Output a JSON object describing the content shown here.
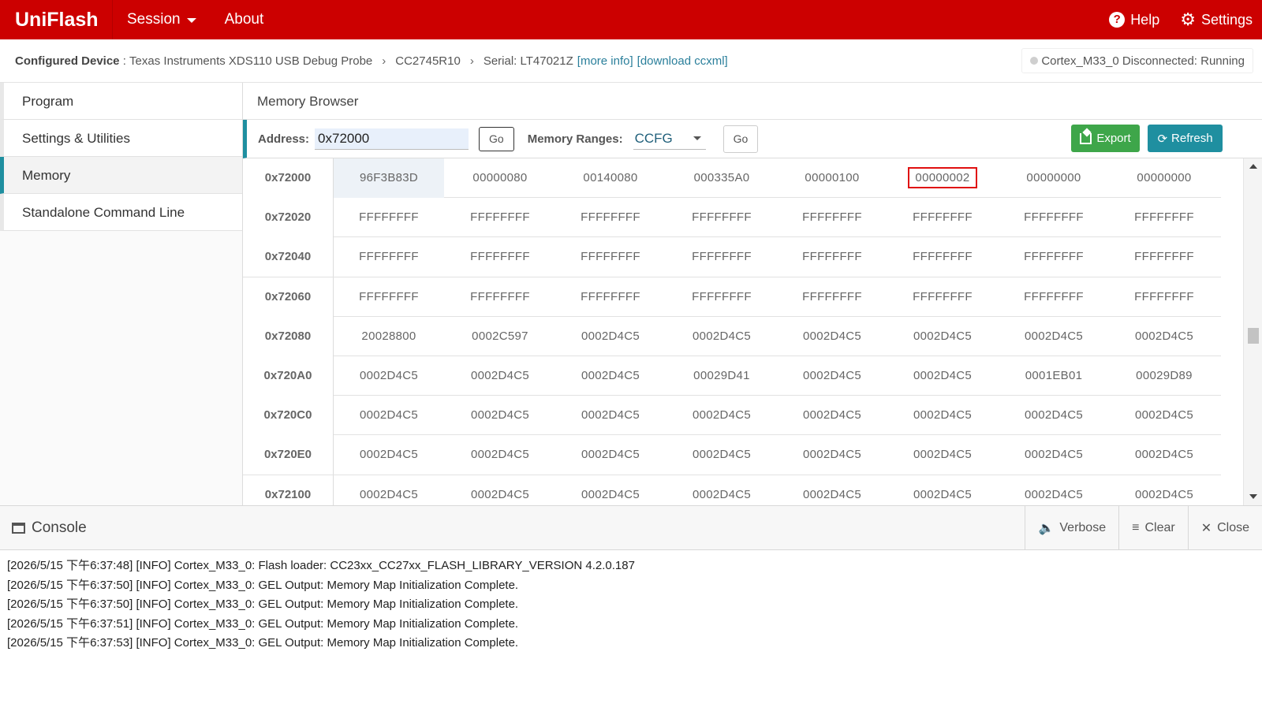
{
  "app": {
    "brand": "UniFlash",
    "menu": [
      {
        "label": "Session"
      },
      {
        "label": "About"
      }
    ],
    "help_label": "Help",
    "settings_label": "Settings"
  },
  "device": {
    "configured_label": "Configured Device",
    "probe": "Texas Instruments XDS110 USB Debug Probe",
    "chip": "CC2745R10",
    "serial": "Serial: LT47021Z",
    "more_info": "[more info]",
    "download_ccxml": "[download ccxml]",
    "status": "Cortex_M33_0 Disconnected: Running"
  },
  "sidebar": {
    "items": [
      {
        "label": "Program"
      },
      {
        "label": "Settings & Utilities"
      },
      {
        "label": "Memory"
      },
      {
        "label": "Standalone Command Line"
      }
    ]
  },
  "memory": {
    "title": "Memory Browser",
    "address_label": "Address:",
    "address_value": "0x72000",
    "go_label": "Go",
    "ranges_label": "Memory Ranges:",
    "range_value": "CCFG",
    "go2_label": "Go",
    "export_label": "Export",
    "refresh_label": "Refresh",
    "rows": [
      {
        "addr": "0x72000",
        "cells": [
          "96F3B83D",
          "00000080",
          "00140080",
          "000335A0",
          "00000100",
          "00000002",
          "00000000",
          "00000000"
        ]
      },
      {
        "addr": "0x72020",
        "cells": [
          "FFFFFFFF",
          "FFFFFFFF",
          "FFFFFFFF",
          "FFFFFFFF",
          "FFFFFFFF",
          "FFFFFFFF",
          "FFFFFFFF",
          "FFFFFFFF"
        ]
      },
      {
        "addr": "0x72040",
        "cells": [
          "FFFFFFFF",
          "FFFFFFFF",
          "FFFFFFFF",
          "FFFFFFFF",
          "FFFFFFFF",
          "FFFFFFFF",
          "FFFFFFFF",
          "FFFFFFFF"
        ]
      },
      {
        "addr": "0x72060",
        "cells": [
          "FFFFFFFF",
          "FFFFFFFF",
          "FFFFFFFF",
          "FFFFFFFF",
          "FFFFFFFF",
          "FFFFFFFF",
          "FFFFFFFF",
          "FFFFFFFF"
        ]
      },
      {
        "addr": "0x72080",
        "cells": [
          "20028800",
          "0002C597",
          "0002D4C5",
          "0002D4C5",
          "0002D4C5",
          "0002D4C5",
          "0002D4C5",
          "0002D4C5"
        ]
      },
      {
        "addr": "0x720A0",
        "cells": [
          "0002D4C5",
          "0002D4C5",
          "0002D4C5",
          "00029D41",
          "0002D4C5",
          "0002D4C5",
          "0001EB01",
          "00029D89"
        ]
      },
      {
        "addr": "0x720C0",
        "cells": [
          "0002D4C5",
          "0002D4C5",
          "0002D4C5",
          "0002D4C5",
          "0002D4C5",
          "0002D4C5",
          "0002D4C5",
          "0002D4C5"
        ]
      },
      {
        "addr": "0x720E0",
        "cells": [
          "0002D4C5",
          "0002D4C5",
          "0002D4C5",
          "0002D4C5",
          "0002D4C5",
          "0002D4C5",
          "0002D4C5",
          "0002D4C5"
        ]
      },
      {
        "addr": "0x72100",
        "cells": [
          "0002D4C5",
          "0002D4C5",
          "0002D4C5",
          "0002D4C5",
          "0002D4C5",
          "0002D4C5",
          "0002D4C5",
          "0002D4C5"
        ]
      }
    ]
  },
  "console": {
    "title": "Console",
    "verbose_label": "Verbose",
    "clear_label": "Clear",
    "close_label": "Close",
    "lines": [
      "[2026/5/15 下午6:37:48] [INFO] Cortex_M33_0: Flash loader: CC23xx_CC27xx_FLASH_LIBRARY_VERSION 4.2.0.187",
      "[2026/5/15 下午6:37:50] [INFO] Cortex_M33_0: GEL Output: Memory Map Initialization Complete.",
      "[2026/5/15 下午6:37:50] [INFO] Cortex_M33_0: GEL Output: Memory Map Initialization Complete.",
      "[2026/5/15 下午6:37:51] [INFO] Cortex_M33_0: GEL Output: Memory Map Initialization Complete.",
      "[2026/5/15 下午6:37:53] [INFO] Cortex_M33_0: GEL Output: Memory Map Initialization Complete."
    ]
  },
  "colors": {
    "brand_red": "#cc0000",
    "accent_teal": "#1f8fa0",
    "export_green": "#3ea64a",
    "marker_red": "#e01010"
  }
}
